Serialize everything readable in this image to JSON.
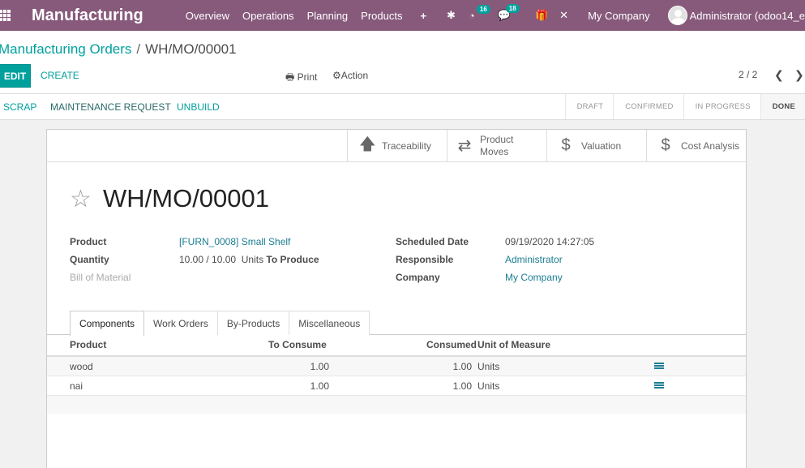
{
  "navbar": {
    "brand": "Manufacturing",
    "menu": [
      "Overview",
      "Operations",
      "Planning",
      "Products"
    ],
    "plus": "+",
    "activity_count": "16",
    "message_count": "18",
    "company": "My Company",
    "user": "Administrator (odoo14_e"
  },
  "breadcrumb": {
    "parent": "Manufacturing Orders",
    "separator": "/",
    "current": "WH/MO/00001"
  },
  "toolbar": {
    "edit_label": "EDIT",
    "create_label": "CREATE",
    "print_label": "Print",
    "action_label": "Action",
    "pager": "2 / 2"
  },
  "statusbar": {
    "buttons": [
      "SCRAP",
      "MAINTENANCE REQUEST",
      "UNBUILD"
    ],
    "stages": [
      "DRAFT",
      "CONFIRMED",
      "IN PROGRESS",
      "DONE"
    ],
    "active_stage": "DONE"
  },
  "smart_buttons": {
    "traceability": "Traceability",
    "product_moves_line1": "Product",
    "product_moves_line2": "Moves",
    "valuation": "Valuation",
    "cost_analysis": "Cost Analysis"
  },
  "record": {
    "title": "WH/MO/00001",
    "fields": {
      "product_label": "Product",
      "product_value": "[FURN_0008] Small Shelf",
      "quantity_label": "Quantity",
      "quantity_value": "10.00  /  10.00",
      "quantity_uom": "Units",
      "quantity_suffix": "To Produce",
      "bom_label": "Bill of Material",
      "scheduled_label": "Scheduled Date",
      "scheduled_value": "09/19/2020 14:27:05",
      "responsible_label": "Responsible",
      "responsible_value": "Administrator",
      "company_label": "Company",
      "company_value": "My Company"
    }
  },
  "tabs": [
    "Components",
    "Work Orders",
    "By-Products",
    "Miscellaneous"
  ],
  "components_table": {
    "headers": {
      "product": "Product",
      "to_consume": "To Consume",
      "consumed": "Consumed",
      "uom": "Unit of Measure"
    },
    "rows": [
      {
        "product": "wood",
        "to_consume": "1.00",
        "consumed": "1.00",
        "uom": "Units"
      },
      {
        "product": "nai",
        "to_consume": "1.00",
        "consumed": "1.00",
        "uom": "Units"
      }
    ]
  }
}
